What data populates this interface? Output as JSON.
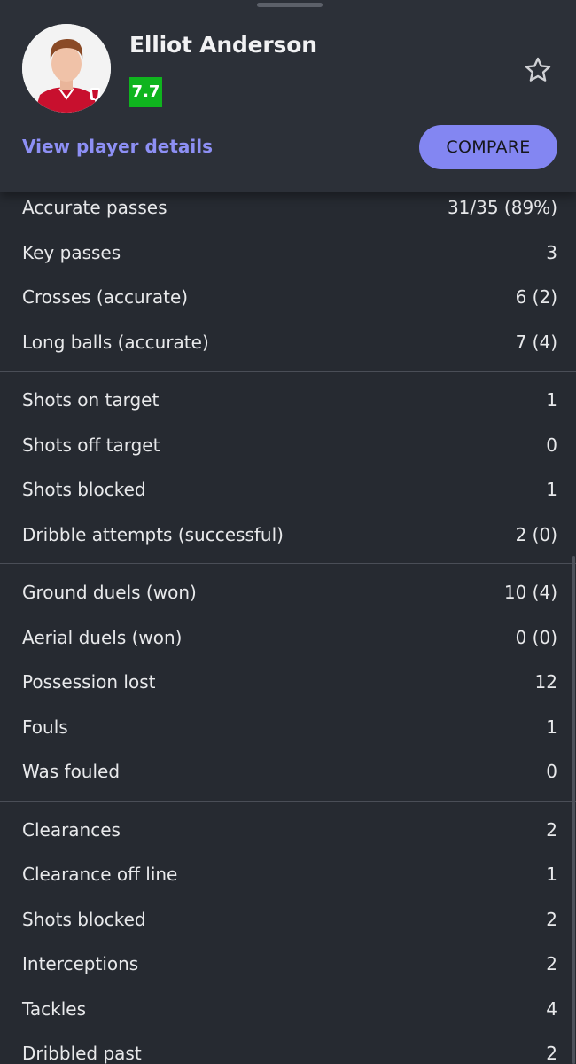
{
  "player": {
    "name": "Elliot Anderson",
    "rating": "7.7",
    "view_details_label": "View player details",
    "compare_label": "COMPARE",
    "rating_color": "#0fb41e",
    "accent_color": "#8386f2"
  },
  "icons": {
    "favorite": "star-outline-icon",
    "avatar": "player-photo"
  },
  "stats": {
    "passing": [
      {
        "label": "Accurate passes",
        "value": "31/35 (89%)"
      },
      {
        "label": "Key passes",
        "value": "3"
      },
      {
        "label": "Crosses (accurate)",
        "value": "6 (2)"
      },
      {
        "label": "Long balls (accurate)",
        "value": "7 (4)"
      }
    ],
    "attack": [
      {
        "label": "Shots on target",
        "value": "1"
      },
      {
        "label": "Shots off target",
        "value": "0"
      },
      {
        "label": "Shots blocked",
        "value": "1"
      },
      {
        "label": "Dribble attempts (successful)",
        "value": "2 (0)"
      }
    ],
    "duels": [
      {
        "label": "Ground duels (won)",
        "value": "10 (4)"
      },
      {
        "label": "Aerial duels (won)",
        "value": "0 (0)"
      },
      {
        "label": "Possession lost",
        "value": "12"
      },
      {
        "label": "Fouls",
        "value": "1"
      },
      {
        "label": "Was fouled",
        "value": "0"
      }
    ],
    "defending": [
      {
        "label": "Clearances",
        "value": "2"
      },
      {
        "label": "Clearance off line",
        "value": "1"
      },
      {
        "label": "Shots blocked",
        "value": "2"
      },
      {
        "label": "Interceptions",
        "value": "2"
      },
      {
        "label": "Tackles",
        "value": "4"
      },
      {
        "label": "Dribbled past",
        "value": "2"
      }
    ]
  }
}
